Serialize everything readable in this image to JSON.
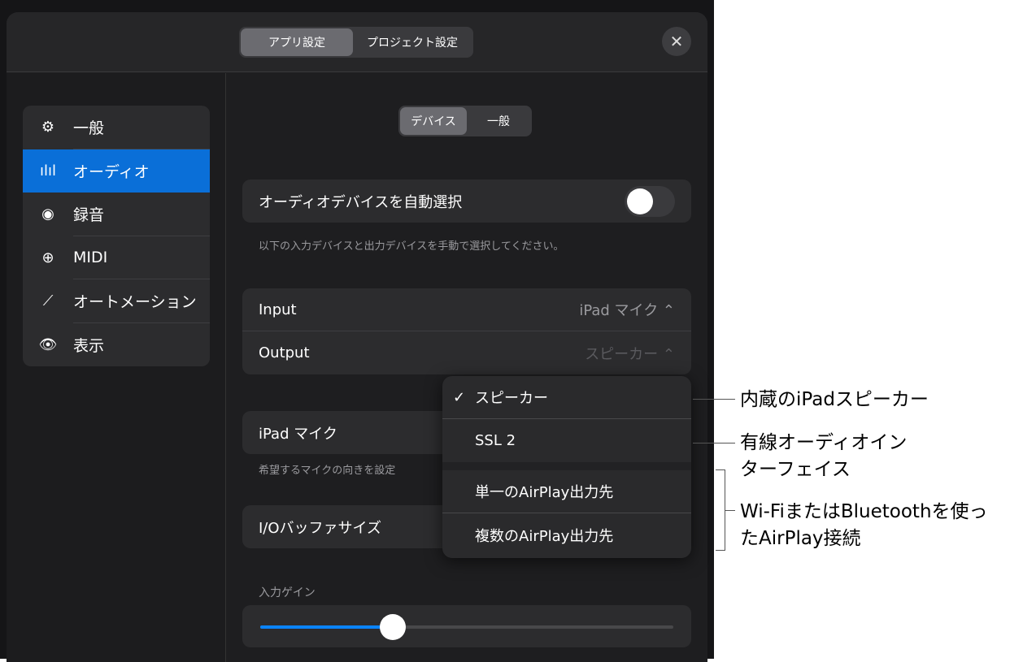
{
  "header": {
    "tabs": [
      "アプリ設定",
      "プロジェクト設定"
    ],
    "close": "✕"
  },
  "sidebar": {
    "items": [
      {
        "icon": "⚙",
        "label": "一般"
      },
      {
        "icon": "ılıl",
        "label": "オーディオ"
      },
      {
        "icon": "◉",
        "label": "録音"
      },
      {
        "icon": "⊕",
        "label": "MIDI"
      },
      {
        "icon": "⟋",
        "label": "オートメーション"
      },
      {
        "icon": "👁",
        "label": "表示"
      }
    ]
  },
  "subtabs": [
    "デバイス",
    "一般"
  ],
  "auto_select": {
    "label": "オーディオデバイスを自動選択",
    "on": false,
    "note": "以下の入力デバイスと出力デバイスを手動で選択してください。"
  },
  "io": {
    "input_label": "Input",
    "input_value": "iPad マイク ⌃",
    "output_label": "Output",
    "output_value": "スピーカー ⌃"
  },
  "mic": {
    "label": "iPad マイク",
    "note": "希望するマイクの向きを設定"
  },
  "buffer": {
    "label": "I/Oバッファサイズ"
  },
  "gain": {
    "label": "入力ゲイン",
    "value": 0.32
  },
  "popup": {
    "check": "✓",
    "items": [
      "スピーカー",
      "SSL 2",
      "単一のAirPlay出力先",
      "複数のAirPlay出力先"
    ]
  },
  "callouts": [
    "内蔵のiPadスピーカー",
    "有線オーディオイン",
    "ターフェイス",
    "Wi-FiまたはBluetoothを使っ",
    "たAirPlay接続"
  ]
}
